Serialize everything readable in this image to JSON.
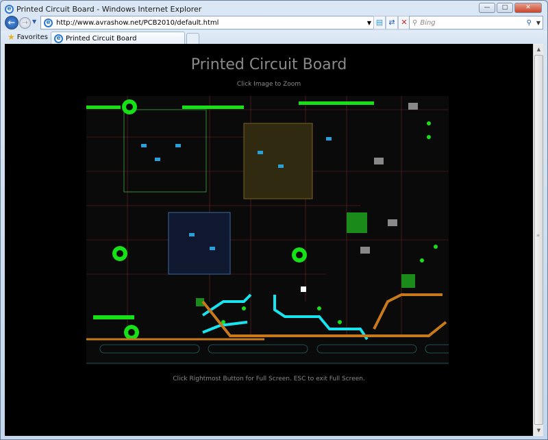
{
  "window": {
    "title": "Printed Circuit Board - Windows Internet Explorer"
  },
  "nav": {
    "url": "http://www.avrashow.net/PCB2010/default.html",
    "search_placeholder": "Bing"
  },
  "favorites": {
    "label": "Favorites"
  },
  "tabs": [
    {
      "label": "Printed Circuit Board"
    }
  ],
  "page": {
    "title": "Printed Circuit Board",
    "subtitle": "Click Image to Zoom",
    "footer": "Click Rightmost Button for Full Screen. ESC to exit Full Screen."
  },
  "colors": {
    "page_bg": "#000000",
    "text": "#8a8a8a",
    "trace_cyan": "#18e4f0",
    "trace_orange": "#c87a1a",
    "pad_green": "#16e016"
  }
}
